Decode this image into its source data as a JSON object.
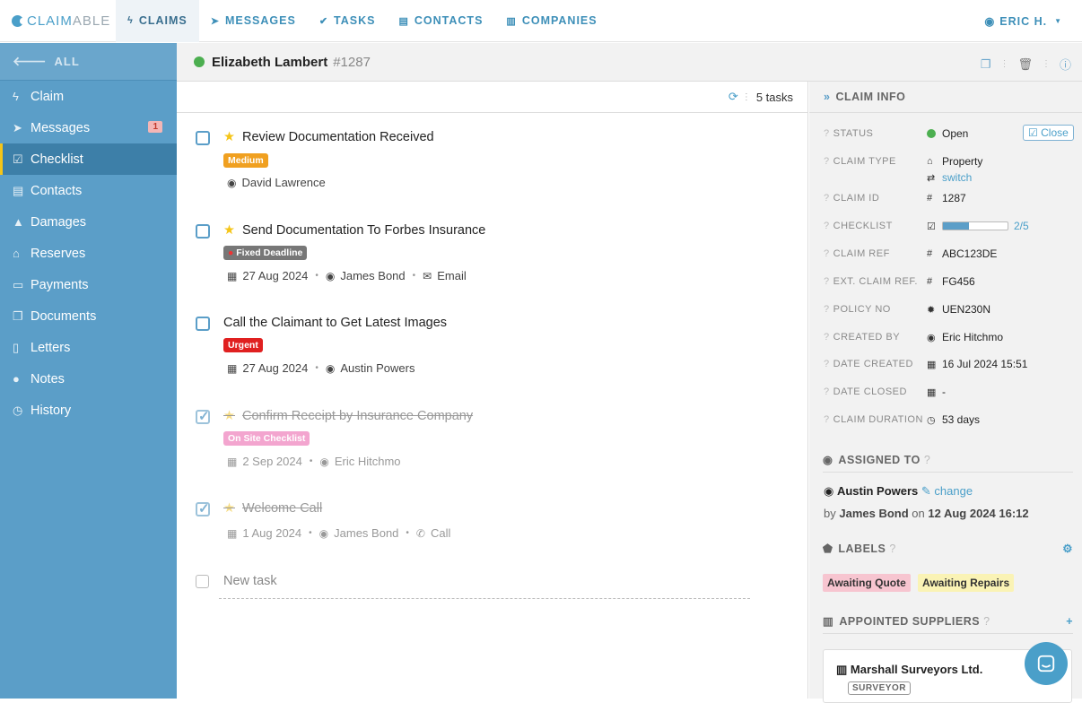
{
  "nav": {
    "logo_bold": "CLAIM",
    "logo_light": "ABLE",
    "items": [
      {
        "label": "CLAIMS",
        "icon": "bolt-icon"
      },
      {
        "label": "MESSAGES",
        "icon": "paper-plane-icon"
      },
      {
        "label": "TASKS",
        "icon": "check-icon"
      },
      {
        "label": "CONTACTS",
        "icon": "address-card-icon"
      },
      {
        "label": "COMPANIES",
        "icon": "building-icon"
      }
    ],
    "user": "ERIC H."
  },
  "sidebar": {
    "all_label": "ALL",
    "items": [
      {
        "label": "Claim",
        "icon": "bolt-icon"
      },
      {
        "label": "Messages",
        "icon": "paper-plane-icon",
        "badge": "1"
      },
      {
        "label": "Checklist",
        "icon": "check-square-icon"
      },
      {
        "label": "Contacts",
        "icon": "address-card-icon"
      },
      {
        "label": "Damages",
        "icon": "warning-icon"
      },
      {
        "label": "Reserves",
        "icon": "bank-icon"
      },
      {
        "label": "Payments",
        "icon": "credit-card-icon"
      },
      {
        "label": "Documents",
        "icon": "copy-icon"
      },
      {
        "label": "Letters",
        "icon": "file-icon"
      },
      {
        "label": "Notes",
        "icon": "comment-icon"
      },
      {
        "label": "History",
        "icon": "clock-icon"
      }
    ]
  },
  "header": {
    "claimant": "Elizabeth Lambert",
    "claim_number": "1287"
  },
  "list": {
    "task_count": "5 tasks",
    "tasks": [
      {
        "title": "Review Documentation Received",
        "tag": "Medium",
        "tag_color": "#f0a020",
        "assignee": "David Lawrence"
      },
      {
        "title": "Send Documentation To Forbes Insurance",
        "tag": "Fixed Deadline",
        "tag_color": "#777777",
        "date": "27 Aug 2024",
        "assignee": "James Bond",
        "method": "Email"
      },
      {
        "title": "Call the Claimant to Get Latest Images",
        "tag": "Urgent",
        "tag_color": "#e02020",
        "date": "27 Aug 2024",
        "assignee": "Austin Powers"
      },
      {
        "title": "Confirm Receipt by Insurance Company",
        "tag": "On Site Checklist",
        "tag_color": "#f3a5cf",
        "date": "2 Sep 2024",
        "assignee": "Eric Hitchmo"
      },
      {
        "title": "Welcome Call",
        "date": "1 Aug 2024",
        "assignee": "James Bond",
        "method": "Call"
      }
    ],
    "new_task_placeholder": "New task"
  },
  "panel": {
    "title": "CLAIM INFO",
    "status_label": "STATUS",
    "status": "Open",
    "close_button": "Close",
    "claim_type_label": "CLAIM TYPE",
    "claim_type": "Property",
    "switch_label": "switch",
    "claim_id_label": "CLAIM ID",
    "claim_id": "1287",
    "checklist_label": "CHECKLIST",
    "checklist_text": "2/5",
    "checklist_progress": 0.4,
    "claim_ref_label": "CLAIM REF",
    "claim_ref": "ABC123DE",
    "ext_ref_label": "EXT. CLAIM REF.",
    "ext_ref": "FG456",
    "policy_label": "POLICY NO",
    "policy": "UEN230N",
    "created_by_label": "CREATED BY",
    "created_by": "Eric Hitchmo",
    "date_created_label": "DATE CREATED",
    "date_created": "16 Jul 2024 15:51",
    "date_closed_label": "DATE CLOSED",
    "date_closed": "-",
    "duration_label": "CLAIM DURATION",
    "duration": "53 days",
    "assigned_title": "ASSIGNED TO",
    "assignee": "Austin Powers",
    "change_label": "change",
    "assigned_by_prefix": "by",
    "assigned_by": "James Bond",
    "assigned_on_prefix": "on",
    "assigned_on": "12 Aug 2024 16:12",
    "labels_title": "LABELS",
    "labels": [
      {
        "text": "Awaiting Quote",
        "color": "#f7c5d0"
      },
      {
        "text": "Awaiting Repairs",
        "color": "#faf3b5"
      }
    ],
    "suppliers_title": "APPOINTED SUPPLIERS",
    "supplier_name": "Marshall Surveyors Ltd.",
    "supplier_type": "SURVEYOR"
  },
  "colors": {
    "accent": "#4a9fc9",
    "sidebar": "#5b9ec8",
    "status_open": "#4caf50"
  }
}
